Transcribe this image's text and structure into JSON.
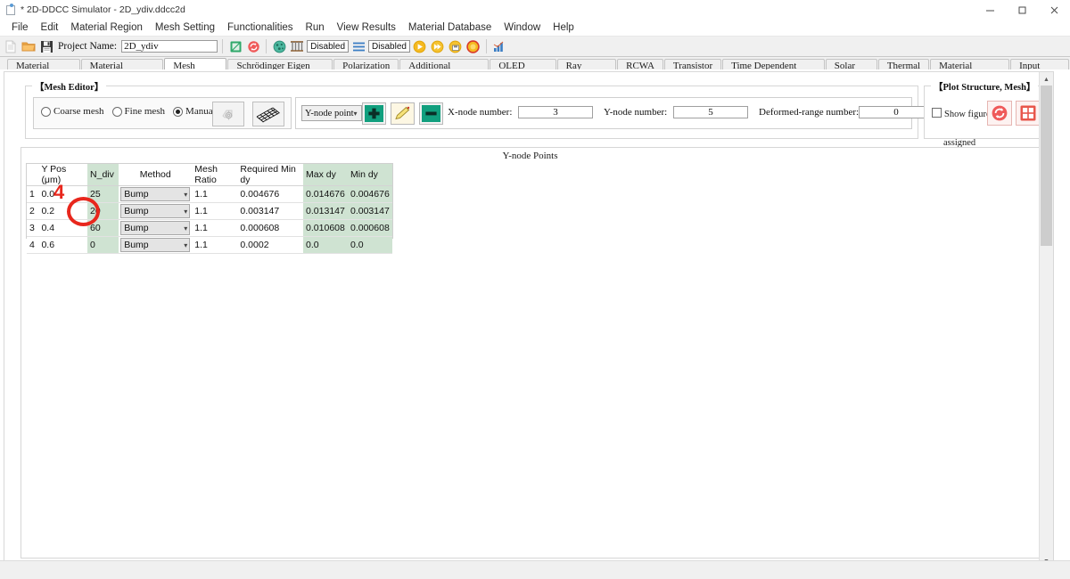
{
  "window": {
    "title": "* 2D-DDCC Simulator - 2D_ydiv.ddcc2d",
    "icon": "app-icon",
    "minimize": "minimize-icon",
    "maximize": "maximize-icon",
    "close": "close-icon"
  },
  "menubar": {
    "items": [
      {
        "label": "File"
      },
      {
        "label": "Edit"
      },
      {
        "label": "Material Region"
      },
      {
        "label": "Mesh Setting"
      },
      {
        "label": "Functionalities"
      },
      {
        "label": "Run"
      },
      {
        "label": "View Results"
      },
      {
        "label": "Material Database"
      },
      {
        "label": "Window"
      },
      {
        "label": "Help"
      }
    ]
  },
  "toolbar": {
    "new_icon": "new-file-icon",
    "open_icon": "open-folder-icon",
    "save_icon": "save-disk-icon",
    "project_label": "Project Name:",
    "project_value": "2D_ydiv",
    "structure_icon": "structure-icon",
    "refresh_icon": "refresh-icon",
    "mesh_icon": "mesh-icon",
    "columns_icon": "columns-icon",
    "status1": "Disabled",
    "lines_icon": "lines-icon",
    "status2": "Disabled",
    "run_icon": "run-icon",
    "run_fast_icon": "run-fast-icon",
    "run_save_icon": "run-save-icon",
    "stop_icon": "stop-icon",
    "chart_icon": "bar-chart-icon"
  },
  "tabs": {
    "active": "Mesh Setting",
    "items": [
      {
        "label": "Material Region"
      },
      {
        "label": "Material Parameter"
      },
      {
        "label": "Mesh Setting"
      },
      {
        "label": "Schrödinger Eigen Solver"
      },
      {
        "label": "Polarization"
      },
      {
        "label": "Additional Functions"
      },
      {
        "label": "OLED Setting"
      },
      {
        "label": "Ray Tracing"
      },
      {
        "label": "RCWA"
      },
      {
        "label": "Transistor"
      },
      {
        "label": "Time Dependent Module"
      },
      {
        "label": "Solar Cell"
      },
      {
        "label": "Thermal"
      },
      {
        "label": "Material Database"
      },
      {
        "label": "Input Editor"
      }
    ]
  },
  "mesh_editor": {
    "group_label": "【Mesh Editor】",
    "radios": [
      {
        "label": "Coarse mesh",
        "selected": false
      },
      {
        "label": "Fine mesh",
        "selected": false
      },
      {
        "label": "Manual mesh",
        "selected": true
      }
    ],
    "gear_button_icon": "gear-mesh-icon",
    "grid_button_icon": "mesh-grid-icon",
    "node_select_value": "Y-node point",
    "add_button_icon": "plus-icon",
    "edit_button_icon": "pencil-icon",
    "remove_button_icon": "minus-icon",
    "x_node_label": "X-node number:",
    "x_node_value": "3",
    "y_node_label": "Y-node number:",
    "y_node_value": "5",
    "deformed_label": "Deformed-range number:",
    "deformed_value": "0",
    "reshape_label": "Reshape after assigned",
    "reshape_checked": false
  },
  "plot_structure": {
    "group_label": "【Plot Structure, Mesh】",
    "show_figure_label": "Show figure",
    "show_figure_checked": false,
    "refresh_icon": "refresh-plot-icon",
    "grid_icon": "grid-plot-icon"
  },
  "ynode_section": {
    "title": "Y-node Points",
    "columns": [
      "Y Pos (μm)",
      "N_div",
      "Method",
      "Mesh Ratio",
      "Required Min dy",
      "Max dy",
      "Min dy"
    ],
    "rows": [
      {
        "n": "1",
        "ypos": "0.0",
        "ndiv": "25",
        "method": "Bump",
        "ratio": "1.1",
        "reqmin": "0.004676",
        "maxdy": "0.014676",
        "mindy": "0.004676"
      },
      {
        "n": "2",
        "ypos": "0.2",
        "ndiv": "20",
        "method": "Bump",
        "ratio": "1.1",
        "reqmin": "0.003147",
        "maxdy": "0.013147",
        "mindy": "0.003147"
      },
      {
        "n": "3",
        "ypos": "0.4",
        "ndiv": "60",
        "method": "Bump",
        "ratio": "1.1",
        "reqmin": "0.000608",
        "maxdy": "0.010608",
        "mindy": "0.000608"
      },
      {
        "n": "4",
        "ypos": "0.6",
        "ndiv": "0",
        "method": "Bump",
        "ratio": "1.1",
        "reqmin": "0.0002",
        "maxdy": "0.0",
        "mindy": "0.0"
      }
    ]
  },
  "annotation": {
    "step_number": "4",
    "highlight_target": "60",
    "color": "#e8271d"
  },
  "colors": {
    "green_cell": "#cfe3d2",
    "accent_red": "#e8271d",
    "teal": "#119f7e",
    "window_bg": "#f0f0f0"
  }
}
